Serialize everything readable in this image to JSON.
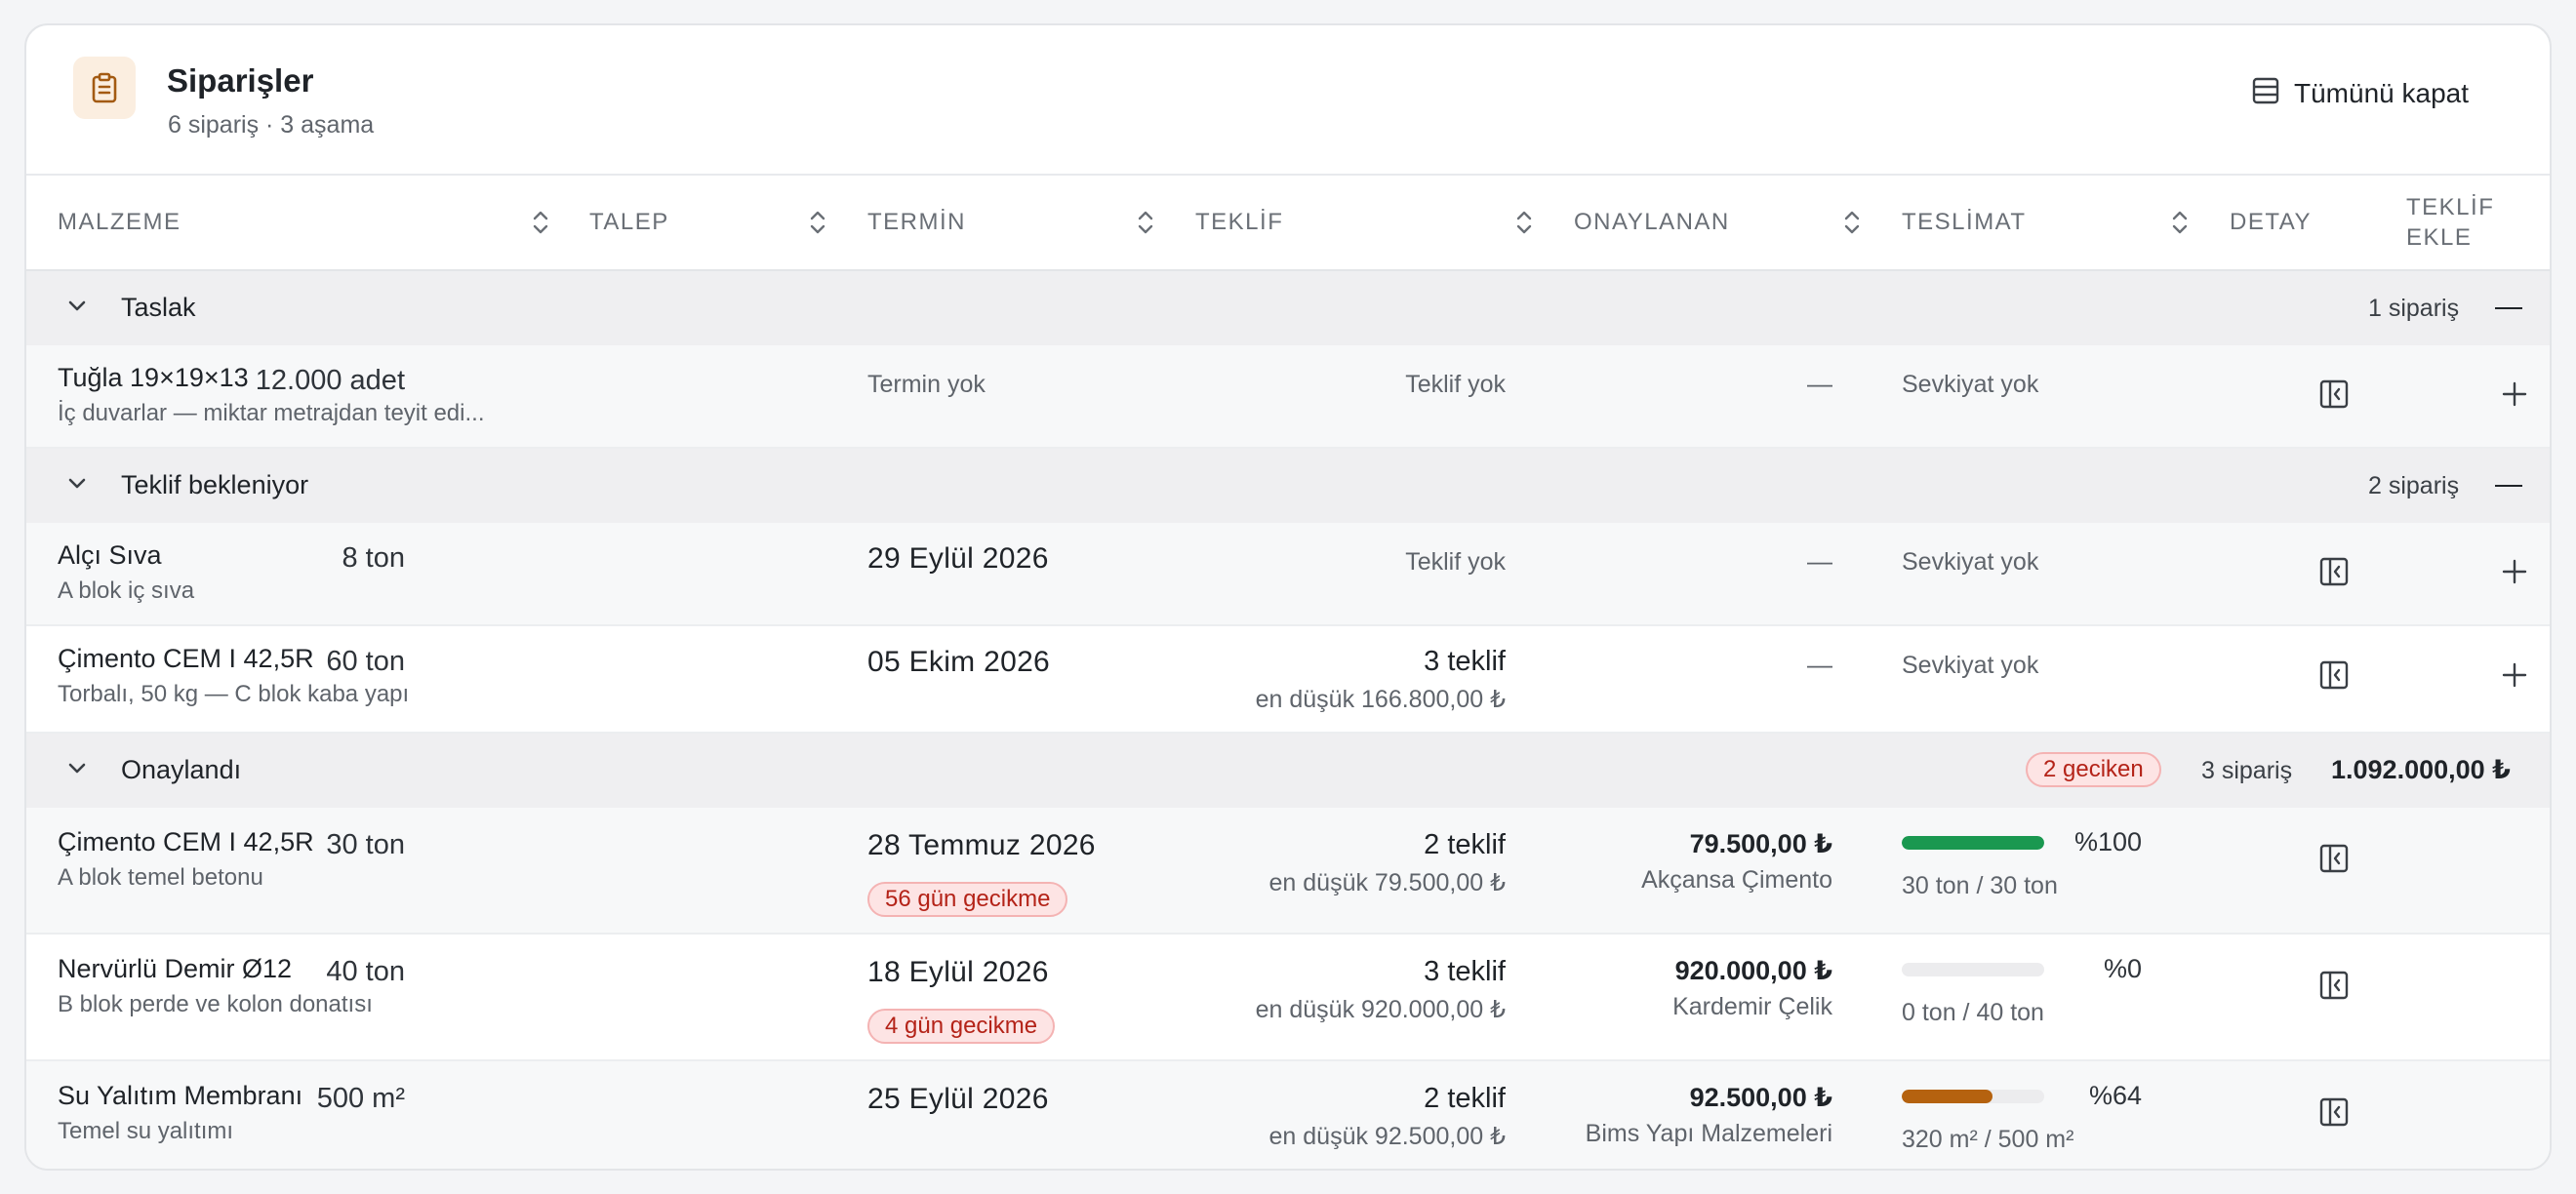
{
  "header": {
    "title": "Siparişler",
    "subtitle": "6 sipariş · 3 aşama",
    "collapse_all_label": "Tümünü kapat",
    "icon": "clipboard-icon"
  },
  "columns": {
    "malzeme": "MALZEME",
    "talep": "TALEP",
    "termin": "TERMİN",
    "teklif": "TEKLİF",
    "onaylanan": "ONAYLANAN",
    "teslimat": "TESLİMAT",
    "detay": "DETAY",
    "teklif_ekle_1": "TEKLİF",
    "teklif_ekle_2": "EKLE"
  },
  "groups": [
    {
      "name": "Taslak",
      "count_label": "1 sipariş",
      "rows": [
        {
          "name": "Tuğla 19×19×13",
          "note": "İç duvarlar — miktar metrajdan teyit edi...",
          "qty": "12.000 adet",
          "termin": "Termin yok",
          "offer": "Teklif yok",
          "approved": "—",
          "shipment": "Sevkiyat yok"
        }
      ]
    },
    {
      "name": "Teklif bekleniyor",
      "count_label": "2 sipariş",
      "rows": [
        {
          "name": "Alçı Sıva",
          "note": "A blok iç sıva",
          "qty": "8 ton",
          "termin": "29 Eylül 2026",
          "offer": "Teklif yok",
          "approved": "—",
          "shipment": "Sevkiyat yok"
        },
        {
          "name": "Çimento CEM I 42,5R",
          "note": "Torbalı, 50 kg — C blok kaba yapı",
          "qty": "60 ton",
          "termin": "05 Ekim 2026",
          "offer_count": "3 teklif",
          "offer_low": "en düşük 166.800,00 ₺",
          "approved": "—",
          "shipment": "Sevkiyat yok"
        }
      ]
    },
    {
      "name": "Onaylandı",
      "count_label": "3 sipariş",
      "delay_badge": "2 geciken",
      "total": "1.092.000,00 ₺",
      "rows": [
        {
          "name": "Çimento CEM I 42,5R",
          "note": "A blok temel betonu",
          "qty": "30 ton",
          "termin": "28 Temmuz 2026",
          "delay": "56 gün gecikme",
          "offer_count": "2 teklif",
          "offer_low": "en düşük 79.500,00 ₺",
          "approved_price": "79.500,00 ₺",
          "approved_supplier": "Akçansa Çimento",
          "progress_pct": "%100",
          "progress_value": 1.0,
          "progress_color": "#1a9850",
          "progress_qty": "30 ton / 30 ton"
        },
        {
          "name": "Nervürlü Demir Ø12",
          "note": "B blok perde ve kolon donatısı",
          "qty": "40 ton",
          "termin": "18 Eylül 2026",
          "delay": "4 gün gecikme",
          "offer_count": "3 teklif",
          "offer_low": "en düşük 920.000,00 ₺",
          "approved_price": "920.000,00 ₺",
          "approved_supplier": "Kardemir Çelik",
          "progress_pct": "%0",
          "progress_value": 0.0,
          "progress_color": "#1a9850",
          "progress_qty": "0 ton / 40 ton"
        },
        {
          "name": "Su Yalıtım Membranı",
          "note": "Temel su yalıtımı",
          "qty": "500 m²",
          "termin": "25 Eylül 2026",
          "offer_count": "2 teklif",
          "offer_low": "en düşük 92.500,00 ₺",
          "approved_price": "92.500,00 ₺",
          "approved_supplier": "Bims Yapı Malzemeleri",
          "progress_pct": "%64",
          "progress_value": 0.64,
          "progress_color": "#b5620f",
          "progress_qty": "320 m² / 500 m²"
        }
      ]
    }
  ]
}
